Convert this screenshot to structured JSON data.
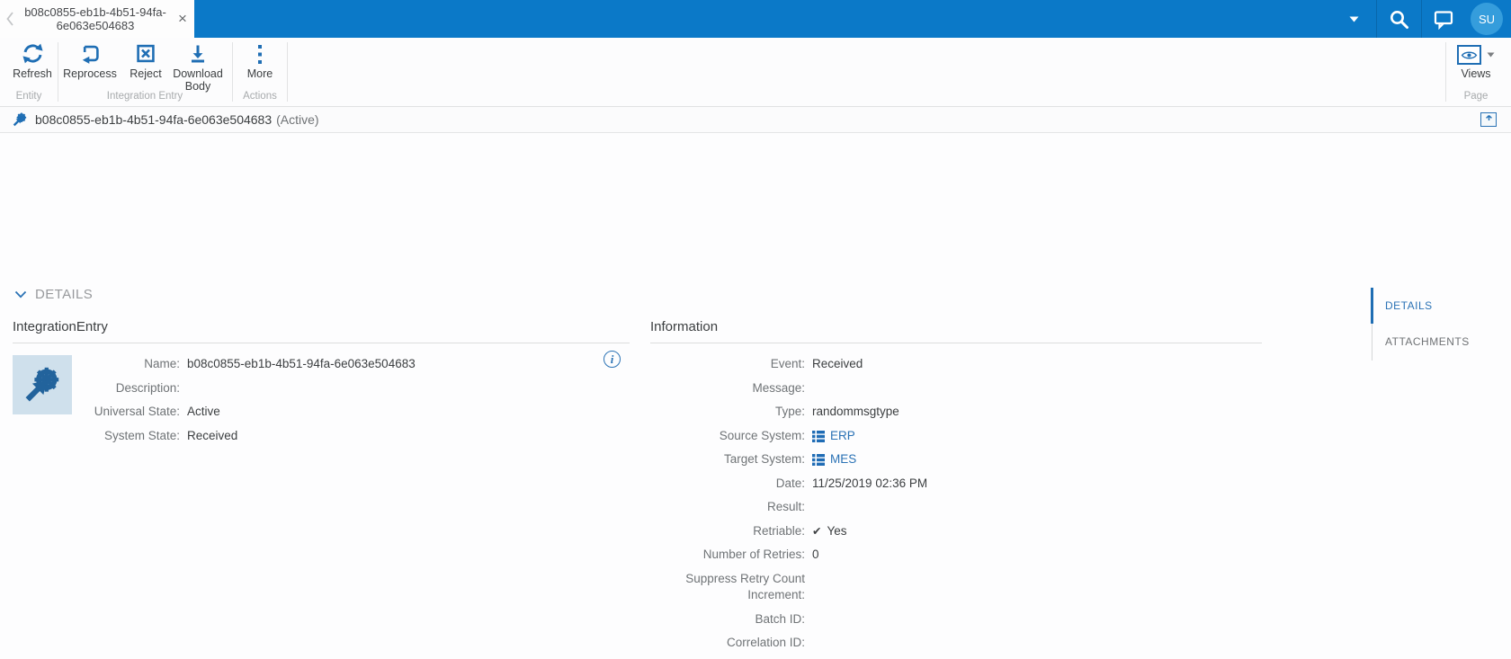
{
  "icons": {
    "check_glyph": "✔",
    "close_glyph": "×",
    "info_glyph": "i"
  },
  "topbar": {
    "tab_title": "b08c0855-eb1b-4b51-94fa-6e063e504683",
    "avatar_initials": "SU"
  },
  "toolbar": {
    "groups": [
      {
        "caption": "Entity",
        "buttons": [
          {
            "label": "Refresh"
          }
        ]
      },
      {
        "caption": "Integration Entry",
        "buttons": [
          {
            "label": "Reprocess"
          },
          {
            "label": "Reject"
          },
          {
            "label": "Download Body"
          }
        ]
      },
      {
        "caption": "Actions",
        "buttons": [
          {
            "label": "More"
          }
        ]
      }
    ],
    "page_group": {
      "caption": "Page",
      "views_label": "Views"
    }
  },
  "titlebar": {
    "title": "b08c0855-eb1b-4b51-94fa-6e063e504683",
    "status": "(Active)"
  },
  "details": {
    "header": "DETAILS",
    "left": {
      "title": "IntegrationEntry",
      "fields": [
        {
          "label": "Name:",
          "value": "b08c0855-eb1b-4b51-94fa-6e063e504683"
        },
        {
          "label": "Description:",
          "value": ""
        },
        {
          "label": "Universal State:",
          "value": "Active"
        },
        {
          "label": "System State:",
          "value": "Received"
        }
      ]
    },
    "right": {
      "title": "Information",
      "fields": [
        {
          "label": "Event:",
          "value": "Received"
        },
        {
          "label": "Message:",
          "value": ""
        },
        {
          "label": "Type:",
          "value": "randommsgtype"
        },
        {
          "label": "Source System:",
          "value": "ERP",
          "type": "entity-link"
        },
        {
          "label": "Target System:",
          "value": "MES",
          "type": "entity-link"
        },
        {
          "label": "Date:",
          "value": "11/25/2019 02:36 PM"
        },
        {
          "label": "Result:",
          "value": ""
        },
        {
          "label": "Retriable:",
          "value": "Yes",
          "type": "check"
        },
        {
          "label": "Number of Retries:",
          "value": "0"
        },
        {
          "label": "Suppress Retry Count Increment:",
          "value": ""
        },
        {
          "label": "Batch ID:",
          "value": ""
        },
        {
          "label": "Correlation ID:",
          "value": ""
        }
      ]
    }
  },
  "side_tabs": {
    "details": "DETAILS",
    "attachments": "ATTACHMENTS"
  },
  "colors": {
    "topbar_blue": "#0b79c8",
    "icon_blue": "#1f6eb4",
    "link_blue": "#2a72b5",
    "avatar_blue": "#359ddc",
    "thumb_bg": "#cfe0ec",
    "active_tab_indicator": "#1f6eb4"
  }
}
